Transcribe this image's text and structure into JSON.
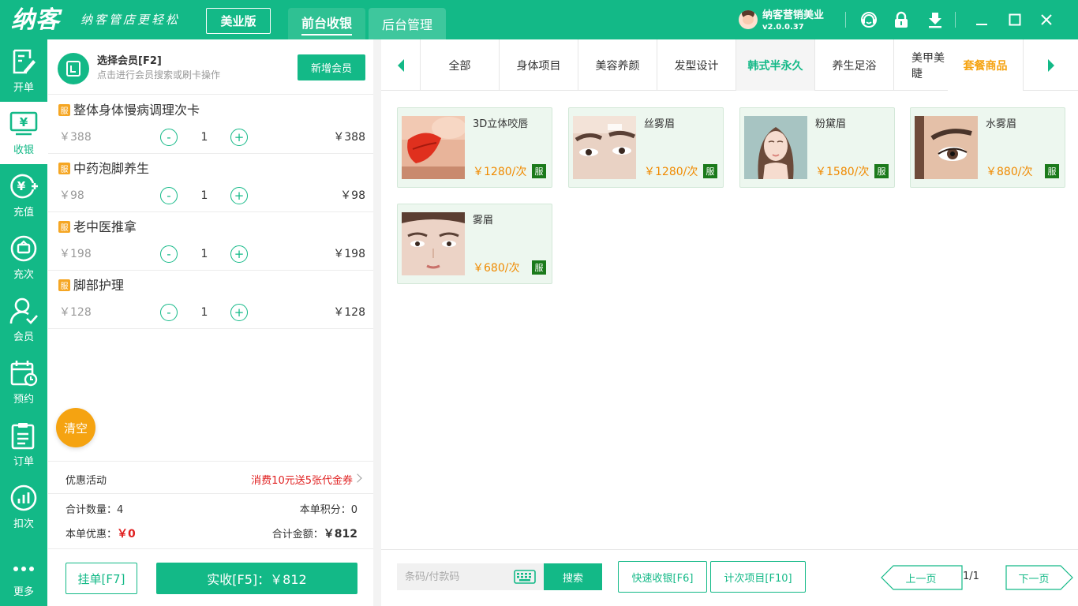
{
  "header": {
    "logo": "纳客",
    "slogan": "纳客管店更轻松",
    "edition": "美业版",
    "tabs": [
      "前台收银",
      "后台管理"
    ],
    "user_name": "纳客营销美业",
    "version": "v2.0.0.37",
    "icons": [
      "customer-service-icon",
      "lock-icon",
      "download-icon",
      "minimize-icon",
      "maximize-icon",
      "close-icon"
    ]
  },
  "sidebar": {
    "items": [
      {
        "label": "开单",
        "icon": "order-edit-icon"
      },
      {
        "label": "收银",
        "icon": "cashier-icon"
      },
      {
        "label": "充值",
        "icon": "recharge-icon"
      },
      {
        "label": "充次",
        "icon": "recharge-times-icon"
      },
      {
        "label": "会员",
        "icon": "member-icon"
      },
      {
        "label": "预约",
        "icon": "appointment-icon"
      },
      {
        "label": "订单",
        "icon": "order-list-icon"
      },
      {
        "label": "扣次",
        "icon": "deduct-icon"
      },
      {
        "label": "更多",
        "icon": "more-icon"
      }
    ],
    "active_index": 1
  },
  "member": {
    "title": "选择会员[F2]",
    "hint": "点击进行会员搜索或刷卡操作",
    "add_button": "新增会员"
  },
  "cart": {
    "badge": "服",
    "items": [
      {
        "name": "整体身体慢病调理次卡",
        "unit_price": "￥388",
        "qty": "1",
        "total": "￥388"
      },
      {
        "name": "中药泡脚养生",
        "unit_price": "￥98",
        "qty": "1",
        "total": "￥98"
      },
      {
        "name": "老中医推拿",
        "unit_price": "￥198",
        "qty": "1",
        "total": "￥198"
      },
      {
        "name": "脚部护理",
        "unit_price": "￥128",
        "qty": "1",
        "total": "￥128"
      }
    ],
    "minus": "-",
    "plus": "+",
    "clear_button": "清空"
  },
  "promo": {
    "label": "优惠活动",
    "value": "消费10元送5张代金券"
  },
  "summary": {
    "qty_label": "合计数量：",
    "qty_value": "4",
    "points_label": "本单积分：",
    "points_value": "0",
    "discount_label": "本单优惠：",
    "discount_value": "￥0",
    "amount_label": "合计金额：",
    "amount_value": "￥812"
  },
  "actions": {
    "hold": "挂单[F7]",
    "pay": "实收[F5]：￥812"
  },
  "categories": {
    "tabs": [
      "全部",
      "身体项目",
      "美容养颜",
      "发型设计",
      "韩式半永久",
      "养生足浴",
      "美甲美睫"
    ],
    "active_index": 4,
    "package": "套餐商品"
  },
  "products": [
    {
      "name": "3D立体咬唇",
      "price": "￥1280/次",
      "badge": "服",
      "image": "lips-photo"
    },
    {
      "name": "丝雾眉",
      "price": "￥1280/次",
      "badge": "服",
      "image": "eyebrow-photo"
    },
    {
      "name": "粉黛眉",
      "price": "￥1580/次",
      "badge": "服",
      "image": "portrait-photo"
    },
    {
      "name": "水雾眉",
      "price": "￥880/次",
      "badge": "服",
      "image": "eye-closeup-photo"
    },
    {
      "name": "雾眉",
      "price": "￥680/次",
      "badge": "服",
      "image": "face-photo"
    }
  ],
  "bottom": {
    "search_placeholder": "条码/付款码",
    "search_button": "搜索",
    "quick_cashier": "快速收银[F6]",
    "count_items": "计次项目[F10]",
    "prev_page": "上一页",
    "page_info": "1/1",
    "next_page": "下一页"
  },
  "colors": {
    "brand": "#13b987",
    "price": "#f08a00",
    "alert": "#e02020",
    "clear": "#f5a311"
  }
}
